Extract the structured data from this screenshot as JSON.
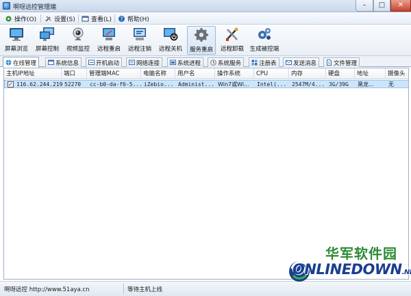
{
  "window": {
    "title": "啊呀远控管理端",
    "min_glyph": "–",
    "max_glyph": "□",
    "close_glyph": "✕"
  },
  "menu": [
    {
      "label": "操作(O)",
      "icon": "gear-menu-icon"
    },
    {
      "label": "设置(S)",
      "icon": "tools-icon"
    },
    {
      "label": "查看(L)",
      "icon": "window-icon"
    },
    {
      "label": "帮助(H)",
      "icon": "help-icon"
    }
  ],
  "toolbar": [
    {
      "label": "屏幕浏览",
      "icon": "monitor-icon"
    },
    {
      "label": "屏幕控制",
      "icon": "screen-control-icon"
    },
    {
      "label": "视频监控",
      "icon": "webcam-icon"
    },
    {
      "label": "远程重启",
      "icon": "restart-icon"
    },
    {
      "label": "远程注销",
      "icon": "logoff-icon"
    },
    {
      "label": "远程关机",
      "icon": "shutdown-icon"
    },
    {
      "label": "服务重启",
      "icon": "service-gear-icon"
    },
    {
      "label": "远程卸载",
      "icon": "uninstall-icon"
    },
    {
      "label": "生成被控端",
      "icon": "build-gears-icon"
    }
  ],
  "tabs": [
    {
      "label": "在线管理",
      "icon": "globe-icon",
      "active": true
    },
    {
      "label": "系统信息",
      "icon": "info-icon"
    },
    {
      "label": "开机启动",
      "icon": "startup-icon"
    },
    {
      "label": "网络连接",
      "icon": "network-icon"
    },
    {
      "label": "系统进程",
      "icon": "process-icon"
    },
    {
      "label": "系统服务",
      "icon": "service-icon"
    },
    {
      "label": "注册表",
      "icon": "registry-icon"
    },
    {
      "label": "发送消息",
      "icon": "message-icon"
    },
    {
      "label": "文件管理",
      "icon": "file-icon"
    }
  ],
  "table": {
    "columns": [
      "主机IP地址",
      "端口",
      "管理端MAC",
      "电脑名称",
      "用户名",
      "操作系统",
      "CPU",
      "内存",
      "硬盘",
      "地址",
      "摄像头"
    ],
    "rows": [
      {
        "checked": true,
        "cells": [
          "116.62.244.219",
          "52270",
          "cc-b0-da-f6-5...",
          "iZebio...",
          "Administ...",
          "Win7或Wi...",
          "Intel(...",
          "2547M/4...",
          "3G/39G",
          "黑龙...",
          "无"
        ]
      }
    ]
  },
  "status": {
    "left": "啊呀远控 http://www.51aya.cn",
    "right": "等待主机上线"
  },
  "watermark": {
    "cn": "华军软件园",
    "en": "ONLINEDOWN",
    "suffix": ".NET"
  },
  "colors": {
    "selection": "#cde5fb",
    "accent": "#2169b8",
    "watermark_green": "#2d8a35",
    "watermark_blue": "#1a3f8e"
  }
}
